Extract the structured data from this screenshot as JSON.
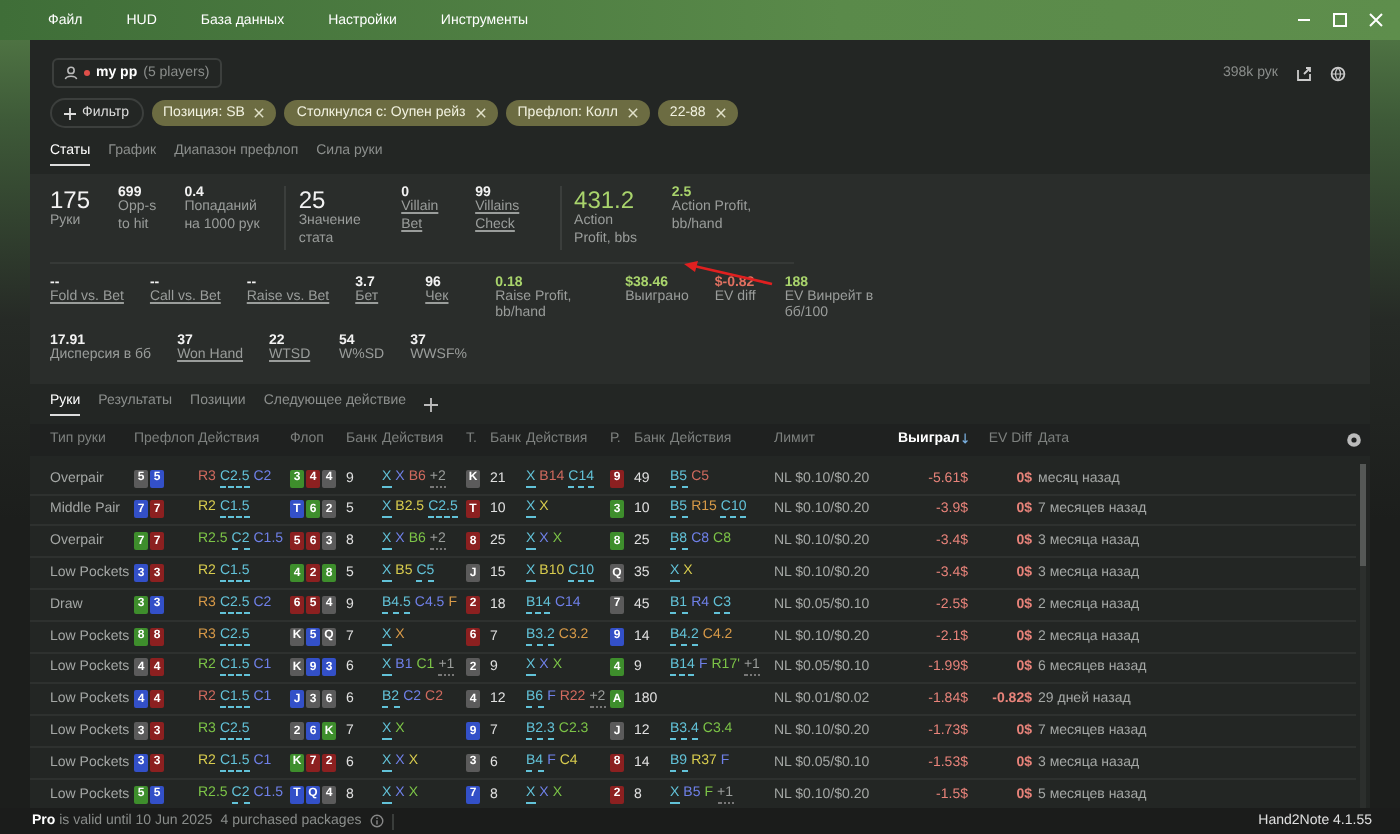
{
  "menu": [
    "Файл",
    "HUD",
    "База данных",
    "Настройки",
    "Инструменты"
  ],
  "player": {
    "name": "my pp",
    "count": "(5 players)",
    "hands": "398k рук"
  },
  "filter_button": "Фильтр",
  "filters": [
    "Позиция: SB",
    "Столкнулся с: Оупен рейз",
    "Префлоп: Колл",
    "22-88"
  ],
  "stat_tabs": [
    {
      "label": "Статы",
      "selected": true
    },
    {
      "label": "График",
      "selected": false
    },
    {
      "label": "Диапазон префлоп",
      "selected": false
    },
    {
      "label": "Сила руки",
      "selected": false
    }
  ],
  "summary": [
    [
      {
        "value": "175",
        "label": "Руки",
        "kind": "big",
        "link": false
      },
      {
        "value": "699",
        "label": "Opp-s to hit",
        "kind": "small",
        "link": false
      },
      {
        "value": "0.4",
        "label": "Попаданий на 1000 рук",
        "kind": "small",
        "link": false
      }
    ],
    [
      {
        "value": "25",
        "label": "Значение стата",
        "kind": "big",
        "link": false
      },
      {
        "value": "0",
        "label": "Villain Bet",
        "kind": "small",
        "link": true
      },
      {
        "value": "99",
        "label": "Villains Check",
        "kind": "small",
        "link": true
      }
    ],
    [
      {
        "value": "431.2",
        "label": "Action Profit, bbs",
        "kind": "big",
        "link": false,
        "color": "#a9d46c"
      },
      {
        "value": "2.5",
        "label": "Action Profit, bb/hand",
        "kind": "small",
        "link": false,
        "color": "#a9d46c"
      }
    ]
  ],
  "details": [
    [
      {
        "value": "--",
        "label": "Fold vs. Bet",
        "link": true
      },
      {
        "value": "--",
        "label": "Call vs. Bet",
        "link": true
      },
      {
        "value": "--",
        "label": "Raise vs. Bet",
        "link": true
      },
      {
        "value": "3.7",
        "label": "Бет",
        "link": true
      },
      {
        "value": "96",
        "label": "Чек",
        "link": true
      },
      {
        "value": "0.18",
        "label": "Raise Profit, bb/hand",
        "link": false,
        "color": "#a9d46c"
      },
      {
        "value": "$38.46",
        "label": "Выиграно",
        "link": false,
        "color": "#a9d46c"
      },
      {
        "value": "$-0.82",
        "label": "EV diff",
        "link": false,
        "color": "#e07060"
      },
      {
        "value": "188",
        "label": "EV Винрейт в бб/100",
        "link": false,
        "color": "#a9d46c"
      }
    ],
    [
      {
        "value": "17.91",
        "label": "Дисперсия в бб",
        "link": false
      },
      {
        "value": "37",
        "label": "Won Hand",
        "link": true
      },
      {
        "value": "22",
        "label": "WTSD",
        "link": true
      },
      {
        "value": "54",
        "label": "W%SD",
        "link": false
      },
      {
        "value": "37",
        "label": "WWSF%",
        "link": false
      }
    ]
  ],
  "hand_tabs": [
    {
      "label": "Руки",
      "selected": true
    },
    {
      "label": "Результаты",
      "selected": false
    },
    {
      "label": "Позиции",
      "selected": false
    },
    {
      "label": "Следующее действие",
      "selected": false
    }
  ],
  "columns": [
    {
      "label": "Тип руки",
      "sorted": false
    },
    {
      "label": "Префлоп",
      "sorted": false
    },
    {
      "label": "Действия",
      "sorted": false
    },
    {
      "label": "Флоп",
      "sorted": false
    },
    {
      "label": "Банк",
      "sorted": false
    },
    {
      "label": "Действия",
      "sorted": false
    },
    {
      "label": "Т.",
      "sorted": false
    },
    {
      "label": "Банк",
      "sorted": false
    },
    {
      "label": "Действия",
      "sorted": false
    },
    {
      "label": "Р.",
      "sorted": false
    },
    {
      "label": "Банк",
      "sorted": false
    },
    {
      "label": "Действия",
      "sorted": false
    },
    {
      "label": "Лимит",
      "sorted": false
    },
    {
      "label": "Выиграл",
      "sorted": true
    },
    {
      "label": "EV Diff",
      "sorted": false
    },
    {
      "label": "Дата",
      "sorted": false
    }
  ],
  "rows": [
    {
      "type": "Overpair",
      "preflop": {
        "cards": [
          {
            "r": "5",
            "color": "#5b5b5b"
          },
          {
            "r": "5",
            "color": "#3350c8"
          }
        ],
        "actions": [
          {
            "a": "R3",
            "color": "#d06a5e",
            "hero": false
          },
          {
            "a": "C2.5",
            "color": "#62c2d8",
            "hero": true
          },
          {
            "a": "C2",
            "color": "#6f80e8",
            "hero": false
          }
        ]
      },
      "flop": {
        "cards": [
          {
            "r": "3",
            "color": "#3e8e2c"
          },
          {
            "r": "4",
            "color": "#8c2020"
          },
          {
            "r": "4",
            "color": "#5b5b5b"
          }
        ],
        "pot": "9",
        "actions": [
          {
            "a": "X",
            "color": "#62c2d8",
            "hero": true
          },
          {
            "a": "X",
            "color": "#6f80e8",
            "hero": false
          },
          {
            "a": "B6",
            "color": "#d06a5e",
            "hero": false
          }
        ],
        "more": "+2"
      },
      "turn": {
        "cards": [
          {
            "r": "K",
            "color": "#5b5b5b"
          }
        ],
        "pot": "21",
        "actions": [
          {
            "a": "X",
            "color": "#62c2d8",
            "hero": true
          },
          {
            "a": "B14",
            "color": "#d06a5e",
            "hero": false
          },
          {
            "a": "C14",
            "color": "#62c2d8",
            "hero": true
          }
        ]
      },
      "river": {
        "cards": [
          {
            "r": "9",
            "color": "#8c2020"
          }
        ],
        "pot": "49",
        "actions": [
          {
            "a": "B5",
            "color": "#62c2d8",
            "hero": true
          },
          {
            "a": "C5",
            "color": "#d06a5e",
            "hero": false
          }
        ]
      },
      "limit": "NL $0.10/$0.20",
      "won": "-5.61$",
      "ev_diff": "0$",
      "date": "месяц назад"
    },
    {
      "type": "Middle Pair",
      "preflop": {
        "cards": [
          {
            "r": "7",
            "color": "#3350c8"
          },
          {
            "r": "7",
            "color": "#8c2020"
          }
        ],
        "actions": [
          {
            "a": "R2",
            "color": "#d8cc4e",
            "hero": false
          },
          {
            "a": "C1.5",
            "color": "#62c2d8",
            "hero": true
          }
        ]
      },
      "flop": {
        "cards": [
          {
            "r": "T",
            "color": "#3350c8"
          },
          {
            "r": "6",
            "color": "#3e8e2c"
          },
          {
            "r": "2",
            "color": "#5b5b5b"
          }
        ],
        "pot": "5",
        "actions": [
          {
            "a": "X",
            "color": "#62c2d8",
            "hero": true
          },
          {
            "a": "B2.5",
            "color": "#d8cc4e",
            "hero": false
          },
          {
            "a": "C2.5",
            "color": "#62c2d8",
            "hero": true
          }
        ]
      },
      "turn": {
        "cards": [
          {
            "r": "T",
            "color": "#8c2020"
          }
        ],
        "pot": "10",
        "actions": [
          {
            "a": "X",
            "color": "#62c2d8",
            "hero": true
          },
          {
            "a": "X",
            "color": "#d8cc4e",
            "hero": false
          }
        ]
      },
      "river": {
        "cards": [
          {
            "r": "3",
            "color": "#3e8e2c"
          }
        ],
        "pot": "10",
        "actions": [
          {
            "a": "B5",
            "color": "#62c2d8",
            "hero": true
          },
          {
            "a": "R15",
            "color": "#d89a48",
            "hero": false
          },
          {
            "a": "C10",
            "color": "#62c2d8",
            "hero": true
          }
        ]
      },
      "limit": "NL $0.10/$0.20",
      "won": "-3.9$",
      "ev_diff": "0$",
      "date": "7 месяцев назад"
    },
    {
      "type": "Overpair",
      "preflop": {
        "cards": [
          {
            "r": "7",
            "color": "#3e8e2c"
          },
          {
            "r": "7",
            "color": "#8c2020"
          }
        ],
        "actions": [
          {
            "a": "R2.5",
            "color": "#7cc447",
            "hero": false
          },
          {
            "a": "C2",
            "color": "#62c2d8",
            "hero": true
          },
          {
            "a": "C1.5",
            "color": "#6f80e8",
            "hero": false
          }
        ]
      },
      "flop": {
        "cards": [
          {
            "r": "5",
            "color": "#8c2020"
          },
          {
            "r": "6",
            "color": "#8c2020"
          },
          {
            "r": "3",
            "color": "#5b5b5b"
          }
        ],
        "pot": "8",
        "actions": [
          {
            "a": "X",
            "color": "#62c2d8",
            "hero": true
          },
          {
            "a": "X",
            "color": "#6f80e8",
            "hero": false
          },
          {
            "a": "B6",
            "color": "#7cc447",
            "hero": false
          }
        ],
        "more": "+2"
      },
      "turn": {
        "cards": [
          {
            "r": "8",
            "color": "#8c2020"
          }
        ],
        "pot": "25",
        "actions": [
          {
            "a": "X",
            "color": "#62c2d8",
            "hero": true
          },
          {
            "a": "X",
            "color": "#6f80e8",
            "hero": false
          },
          {
            "a": "X",
            "color": "#7cc447",
            "hero": false
          }
        ]
      },
      "river": {
        "cards": [
          {
            "r": "8",
            "color": "#3e8e2c"
          }
        ],
        "pot": "25",
        "actions": [
          {
            "a": "B8",
            "color": "#62c2d8",
            "hero": true
          },
          {
            "a": "C8",
            "color": "#6f80e8",
            "hero": false
          },
          {
            "a": "C8",
            "color": "#7cc447",
            "hero": false
          }
        ]
      },
      "limit": "NL $0.10/$0.20",
      "won": "-3.4$",
      "ev_diff": "0$",
      "date": "3 месяца назад"
    },
    {
      "type": "Low Pockets",
      "preflop": {
        "cards": [
          {
            "r": "3",
            "color": "#3350c8"
          },
          {
            "r": "3",
            "color": "#8c2020"
          }
        ],
        "actions": [
          {
            "a": "R2",
            "color": "#d8cc4e",
            "hero": false
          },
          {
            "a": "C1.5",
            "color": "#62c2d8",
            "hero": true
          }
        ]
      },
      "flop": {
        "cards": [
          {
            "r": "4",
            "color": "#3e8e2c"
          },
          {
            "r": "2",
            "color": "#8c2020"
          },
          {
            "r": "8",
            "color": "#3e8e2c"
          }
        ],
        "pot": "5",
        "actions": [
          {
            "a": "X",
            "color": "#62c2d8",
            "hero": true
          },
          {
            "a": "B5",
            "color": "#d8cc4e",
            "hero": false
          },
          {
            "a": "C5",
            "color": "#62c2d8",
            "hero": true
          }
        ]
      },
      "turn": {
        "cards": [
          {
            "r": "J",
            "color": "#5b5b5b"
          }
        ],
        "pot": "15",
        "actions": [
          {
            "a": "X",
            "color": "#62c2d8",
            "hero": true
          },
          {
            "a": "B10",
            "color": "#d8cc4e",
            "hero": false
          },
          {
            "a": "C10",
            "color": "#62c2d8",
            "hero": true
          }
        ]
      },
      "river": {
        "cards": [
          {
            "r": "Q",
            "color": "#5b5b5b"
          }
        ],
        "pot": "35",
        "actions": [
          {
            "a": "X",
            "color": "#62c2d8",
            "hero": true
          },
          {
            "a": "X",
            "color": "#d8cc4e",
            "hero": false
          }
        ]
      },
      "limit": "NL $0.10/$0.20",
      "won": "-3.4$",
      "ev_diff": "0$",
      "date": "3 месяца назад"
    },
    {
      "type": "Draw",
      "preflop": {
        "cards": [
          {
            "r": "3",
            "color": "#3e8e2c"
          },
          {
            "r": "3",
            "color": "#3350c8"
          }
        ],
        "actions": [
          {
            "a": "R3",
            "color": "#d89a48",
            "hero": false
          },
          {
            "a": "C2.5",
            "color": "#62c2d8",
            "hero": true
          },
          {
            "a": "C2",
            "color": "#6f80e8",
            "hero": false
          }
        ]
      },
      "flop": {
        "cards": [
          {
            "r": "6",
            "color": "#8c2020"
          },
          {
            "r": "5",
            "color": "#8c2020"
          },
          {
            "r": "4",
            "color": "#5b5b5b"
          }
        ],
        "pot": "9",
        "actions": [
          {
            "a": "B4.5",
            "color": "#62c2d8",
            "hero": true
          },
          {
            "a": "C4.5",
            "color": "#6f80e8",
            "hero": false
          },
          {
            "a": "F",
            "color": "#d89a48",
            "hero": false
          }
        ]
      },
      "turn": {
        "cards": [
          {
            "r": "2",
            "color": "#8c2020"
          }
        ],
        "pot": "18",
        "actions": [
          {
            "a": "B14",
            "color": "#62c2d8",
            "hero": true
          },
          {
            "a": "C14",
            "color": "#6f80e8",
            "hero": false
          }
        ]
      },
      "river": {
        "cards": [
          {
            "r": "7",
            "color": "#5b5b5b"
          }
        ],
        "pot": "45",
        "actions": [
          {
            "a": "B1",
            "color": "#62c2d8",
            "hero": true
          },
          {
            "a": "R4",
            "color": "#6f80e8",
            "hero": false
          },
          {
            "a": "C3",
            "color": "#62c2d8",
            "hero": true
          }
        ]
      },
      "limit": "NL $0.05/$0.10",
      "won": "-2.5$",
      "ev_diff": "0$",
      "date": "2 месяца назад"
    },
    {
      "type": "Low Pockets",
      "preflop": {
        "cards": [
          {
            "r": "8",
            "color": "#3e8e2c"
          },
          {
            "r": "8",
            "color": "#8c2020"
          }
        ],
        "actions": [
          {
            "a": "R3",
            "color": "#d89a48",
            "hero": false
          },
          {
            "a": "C2.5",
            "color": "#62c2d8",
            "hero": true
          }
        ]
      },
      "flop": {
        "cards": [
          {
            "r": "K",
            "color": "#5b5b5b"
          },
          {
            "r": "5",
            "color": "#3350c8"
          },
          {
            "r": "Q",
            "color": "#5b5b5b"
          }
        ],
        "pot": "7",
        "actions": [
          {
            "a": "X",
            "color": "#62c2d8",
            "hero": true
          },
          {
            "a": "X",
            "color": "#d89a48",
            "hero": false
          }
        ]
      },
      "turn": {
        "cards": [
          {
            "r": "6",
            "color": "#8c2020"
          }
        ],
        "pot": "7",
        "actions": [
          {
            "a": "B3.2",
            "color": "#62c2d8",
            "hero": true
          },
          {
            "a": "C3.2",
            "color": "#d89a48",
            "hero": false
          }
        ]
      },
      "river": {
        "cards": [
          {
            "r": "9",
            "color": "#3350c8"
          }
        ],
        "pot": "14",
        "actions": [
          {
            "a": "B4.2",
            "color": "#62c2d8",
            "hero": true
          },
          {
            "a": "C4.2",
            "color": "#d89a48",
            "hero": false
          }
        ]
      },
      "limit": "NL $0.10/$0.20",
      "won": "-2.1$",
      "ev_diff": "0$",
      "date": "2 месяца назад"
    },
    {
      "type": "Low Pockets",
      "preflop": {
        "cards": [
          {
            "r": "4",
            "color": "#5b5b5b"
          },
          {
            "r": "4",
            "color": "#8c2020"
          }
        ],
        "actions": [
          {
            "a": "R2",
            "color": "#7cc447",
            "hero": false
          },
          {
            "a": "C1.5",
            "color": "#62c2d8",
            "hero": true
          },
          {
            "a": "C1",
            "color": "#6f80e8",
            "hero": false
          }
        ]
      },
      "flop": {
        "cards": [
          {
            "r": "K",
            "color": "#5b5b5b"
          },
          {
            "r": "9",
            "color": "#3350c8"
          },
          {
            "r": "3",
            "color": "#3350c8"
          }
        ],
        "pot": "6",
        "actions": [
          {
            "a": "X",
            "color": "#62c2d8",
            "hero": true
          },
          {
            "a": "B1",
            "color": "#6f80e8",
            "hero": false
          },
          {
            "a": "C1",
            "color": "#7cc447",
            "hero": false
          }
        ],
        "more": "+1"
      },
      "turn": {
        "cards": [
          {
            "r": "2",
            "color": "#5b5b5b"
          }
        ],
        "pot": "9",
        "actions": [
          {
            "a": "X",
            "color": "#62c2d8",
            "hero": true
          },
          {
            "a": "X",
            "color": "#6f80e8",
            "hero": false
          },
          {
            "a": "X",
            "color": "#7cc447",
            "hero": false
          }
        ]
      },
      "river": {
        "cards": [
          {
            "r": "4",
            "color": "#3e8e2c"
          }
        ],
        "pot": "9",
        "actions": [
          {
            "a": "B14",
            "color": "#62c2d8",
            "hero": true
          },
          {
            "a": "F",
            "color": "#6f80e8",
            "hero": false
          },
          {
            "a": "R17'",
            "color": "#7cc447",
            "hero": false
          }
        ],
        "more": "+1"
      },
      "limit": "NL $0.05/$0.10",
      "won": "-1.99$",
      "ev_diff": "0$",
      "date": "6 месяцев назад"
    },
    {
      "type": "Low Pockets",
      "preflop": {
        "cards": [
          {
            "r": "4",
            "color": "#3350c8"
          },
          {
            "r": "4",
            "color": "#8c2020"
          }
        ],
        "actions": [
          {
            "a": "R2",
            "color": "#d06a5e",
            "hero": false
          },
          {
            "a": "C1.5",
            "color": "#62c2d8",
            "hero": true
          },
          {
            "a": "C1",
            "color": "#6f80e8",
            "hero": false
          }
        ]
      },
      "flop": {
        "cards": [
          {
            "r": "J",
            "color": "#3350c8"
          },
          {
            "r": "3",
            "color": "#5b5b5b"
          },
          {
            "r": "6",
            "color": "#5b5b5b"
          }
        ],
        "pot": "6",
        "actions": [
          {
            "a": "B2",
            "color": "#62c2d8",
            "hero": true
          },
          {
            "a": "C2",
            "color": "#6f80e8",
            "hero": false
          },
          {
            "a": "C2",
            "color": "#d06a5e",
            "hero": false
          }
        ]
      },
      "turn": {
        "cards": [
          {
            "r": "4",
            "color": "#5b5b5b"
          }
        ],
        "pot": "12",
        "actions": [
          {
            "a": "B6",
            "color": "#62c2d8",
            "hero": true
          },
          {
            "a": "F",
            "color": "#6f80e8",
            "hero": false
          },
          {
            "a": "R22",
            "color": "#d06a5e",
            "hero": false
          }
        ],
        "more": "+2"
      },
      "river": {
        "cards": [
          {
            "r": "A",
            "color": "#3e8e2c"
          }
        ],
        "pot": "180"
      },
      "limit": "NL $0.01/$0.02",
      "won": "-1.84$",
      "ev_diff": "-0.82$",
      "date": "29 дней назад"
    },
    {
      "type": "Low Pockets",
      "preflop": {
        "cards": [
          {
            "r": "3",
            "color": "#5b5b5b"
          },
          {
            "r": "3",
            "color": "#8c2020"
          }
        ],
        "actions": [
          {
            "a": "R3",
            "color": "#7cc447",
            "hero": false
          },
          {
            "a": "C2.5",
            "color": "#62c2d8",
            "hero": true
          }
        ]
      },
      "flop": {
        "cards": [
          {
            "r": "2",
            "color": "#5b5b5b"
          },
          {
            "r": "6",
            "color": "#3350c8"
          },
          {
            "r": "K",
            "color": "#3e8e2c"
          }
        ],
        "pot": "7",
        "actions": [
          {
            "a": "X",
            "color": "#62c2d8",
            "hero": true
          },
          {
            "a": "X",
            "color": "#7cc447",
            "hero": false
          }
        ]
      },
      "turn": {
        "cards": [
          {
            "r": "9",
            "color": "#3350c8"
          }
        ],
        "pot": "7",
        "actions": [
          {
            "a": "B2.3",
            "color": "#62c2d8",
            "hero": true
          },
          {
            "a": "C2.3",
            "color": "#7cc447",
            "hero": false
          }
        ]
      },
      "river": {
        "cards": [
          {
            "r": "J",
            "color": "#5b5b5b"
          }
        ],
        "pot": "12",
        "actions": [
          {
            "a": "B3.4",
            "color": "#62c2d8",
            "hero": true
          },
          {
            "a": "C3.4",
            "color": "#7cc447",
            "hero": false
          }
        ]
      },
      "limit": "NL $0.10/$0.20",
      "won": "-1.73$",
      "ev_diff": "0$",
      "date": "7 месяцев назад"
    },
    {
      "type": "Low Pockets",
      "preflop": {
        "cards": [
          {
            "r": "3",
            "color": "#3350c8"
          },
          {
            "r": "3",
            "color": "#8c2020"
          }
        ],
        "actions": [
          {
            "a": "R2",
            "color": "#d8cc4e",
            "hero": false
          },
          {
            "a": "C1.5",
            "color": "#62c2d8",
            "hero": true
          },
          {
            "a": "C1",
            "color": "#6f80e8",
            "hero": false
          }
        ]
      },
      "flop": {
        "cards": [
          {
            "r": "K",
            "color": "#3e8e2c"
          },
          {
            "r": "7",
            "color": "#8c2020"
          },
          {
            "r": "2",
            "color": "#8c2020"
          }
        ],
        "pot": "6",
        "actions": [
          {
            "a": "X",
            "color": "#62c2d8",
            "hero": true
          },
          {
            "a": "X",
            "color": "#6f80e8",
            "hero": false
          },
          {
            "a": "X",
            "color": "#d8cc4e",
            "hero": false
          }
        ]
      },
      "turn": {
        "cards": [
          {
            "r": "3",
            "color": "#5b5b5b"
          }
        ],
        "pot": "6",
        "actions": [
          {
            "a": "B4",
            "color": "#62c2d8",
            "hero": true
          },
          {
            "a": "F",
            "color": "#6f80e8",
            "hero": false
          },
          {
            "a": "C4",
            "color": "#d8cc4e",
            "hero": false
          }
        ]
      },
      "river": {
        "cards": [
          {
            "r": "8",
            "color": "#8c2020"
          }
        ],
        "pot": "14",
        "actions": [
          {
            "a": "B9",
            "color": "#62c2d8",
            "hero": true
          },
          {
            "a": "R37",
            "color": "#d8cc4e",
            "hero": false
          },
          {
            "a": "F",
            "color": "#6f80e8",
            "hero": false
          }
        ]
      },
      "limit": "NL $0.05/$0.10",
      "won": "-1.53$",
      "ev_diff": "0$",
      "date": "3 месяца назад"
    },
    {
      "type": "Low Pockets",
      "preflop": {
        "cards": [
          {
            "r": "5",
            "color": "#3e8e2c"
          },
          {
            "r": "5",
            "color": "#3350c8"
          }
        ],
        "actions": [
          {
            "a": "R2.5",
            "color": "#7cc447",
            "hero": false
          },
          {
            "a": "C2",
            "color": "#62c2d8",
            "hero": true
          },
          {
            "a": "C1.5",
            "color": "#6f80e8",
            "hero": false
          }
        ]
      },
      "flop": {
        "cards": [
          {
            "r": "T",
            "color": "#3350c8"
          },
          {
            "r": "Q",
            "color": "#3350c8"
          },
          {
            "r": "4",
            "color": "#5b5b5b"
          }
        ],
        "pot": "8",
        "actions": [
          {
            "a": "X",
            "color": "#62c2d8",
            "hero": true
          },
          {
            "a": "X",
            "color": "#6f80e8",
            "hero": false
          },
          {
            "a": "X",
            "color": "#7cc447",
            "hero": false
          }
        ]
      },
      "turn": {
        "cards": [
          {
            "r": "7",
            "color": "#3350c8"
          }
        ],
        "pot": "8",
        "actions": [
          {
            "a": "X",
            "color": "#62c2d8",
            "hero": true
          },
          {
            "a": "X",
            "color": "#6f80e8",
            "hero": false
          },
          {
            "a": "X",
            "color": "#7cc447",
            "hero": false
          }
        ]
      },
      "river": {
        "cards": [
          {
            "r": "2",
            "color": "#8c2020"
          }
        ],
        "pot": "8",
        "actions": [
          {
            "a": "X",
            "color": "#62c2d8",
            "hero": true
          },
          {
            "a": "B5",
            "color": "#6f80e8",
            "hero": false
          },
          {
            "a": "F",
            "color": "#7cc447",
            "hero": false
          }
        ],
        "more": "+1"
      },
      "limit": "NL $0.10/$0.20",
      "won": "-1.5$",
      "ev_diff": "0$",
      "date": "5 месяцев назад"
    }
  ],
  "status": {
    "license": "**Pro** is valid until 10 Jun 2025",
    "packages": "4 purchased packages",
    "version": "Hand2Note 4.1.55"
  }
}
